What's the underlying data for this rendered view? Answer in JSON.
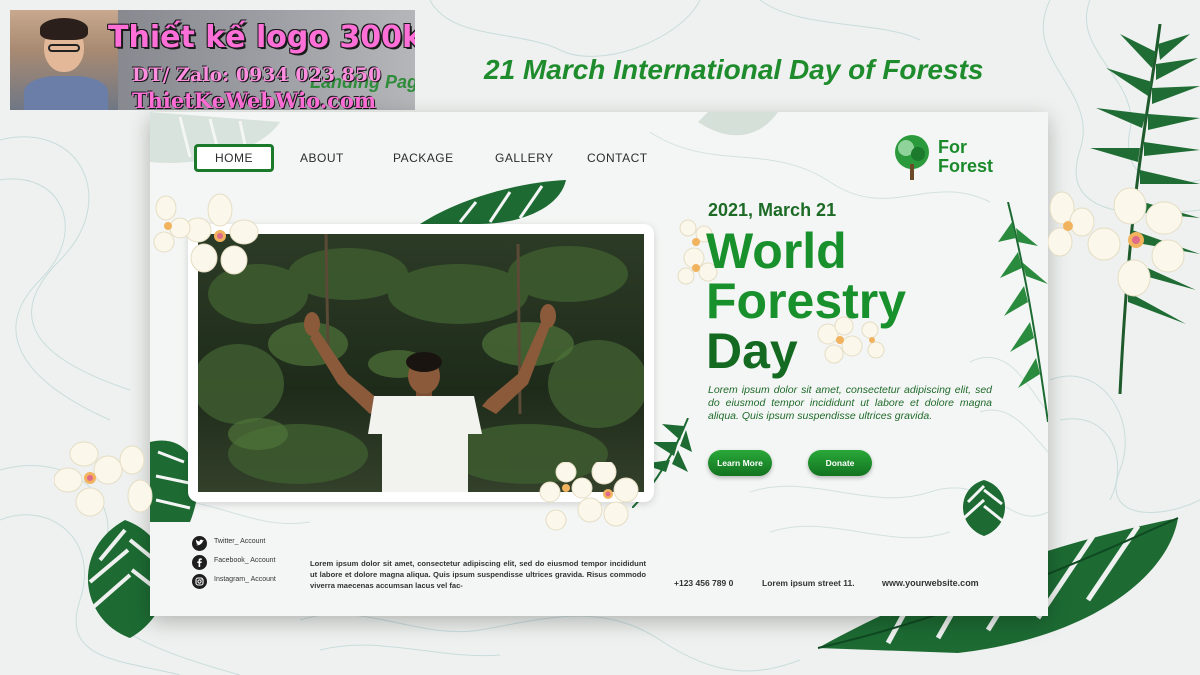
{
  "banner": {
    "title": "Thiết kế logo 300k",
    "phone": "DT/ Zalo: 0934 023 850",
    "website": "ThietKeWebWio.com",
    "underlying_text": "Landing Page Template"
  },
  "top_title": "21 March International Day of Forests",
  "nav": {
    "items": [
      "HOME",
      "ABOUT",
      "PACKAGE",
      "GALLERY",
      "CONTACT"
    ]
  },
  "logo": {
    "line1": "For",
    "line2": "Forest"
  },
  "hero": {
    "date": "2021, March 21",
    "headline_1": "World",
    "headline_2": "Forestry",
    "headline_3": "Day",
    "paragraph": "Lorem ipsum dolor sit amet, consectetur adipiscing elit, sed do eiusmod tempor incididunt ut labore et dolore magna aliqua. Quis ipsum suspendisse ultrices gravida.",
    "learn_more": "Learn More",
    "donate": "Donate"
  },
  "social": [
    {
      "icon": "twitter-icon",
      "label": "Twitter_ Account"
    },
    {
      "icon": "facebook-icon",
      "label": "Facebook_ Account"
    },
    {
      "icon": "instagram-icon",
      "label": "Instagram_ Account"
    }
  ],
  "footer": {
    "paragraph": "Lorem ipsum dolor sit amet, consectetur adipiscing elit, sed do eiusmod tempor incididunt ut labore et dolore magna aliqua. Quis ipsum suspendisse ultrices gravida. Risus commodo viverra maecenas accumsan lacus vel fac-",
    "phone": "+123 456 789 0",
    "address": "Lorem ipsum street 11.",
    "website": "www.yourwebsite.com"
  },
  "colors": {
    "brand_green": "#18902b",
    "dark_green": "#156a22",
    "banner_pink": "#ff6fd8",
    "background": "#eef1ef"
  }
}
